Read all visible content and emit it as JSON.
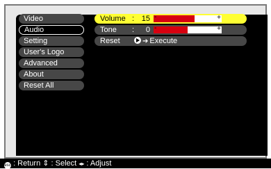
{
  "menu": {
    "items": [
      {
        "label": "Video"
      },
      {
        "label": "Audio"
      },
      {
        "label": "Setting"
      },
      {
        "label": "User's Logo"
      },
      {
        "label": "Advanced"
      },
      {
        "label": "About"
      },
      {
        "label": "Reset All"
      }
    ],
    "selected": "Audio"
  },
  "audio": {
    "volume": {
      "label": "Volume",
      "colon": ":",
      "value": "15",
      "level": 0.6
    },
    "tone": {
      "label": "Tone",
      "colon": ":",
      "value": "0",
      "level": 0.5
    },
    "reset": {
      "label": "Reset",
      "action": "Execute"
    }
  },
  "footer": {
    "return_icon": "esc",
    "return_label": ": Return",
    "select_icon": "⇕",
    "select_label": ": Select",
    "adjust_icon": "◂▸",
    "adjust_label": ": Adjust"
  },
  "colors": {
    "highlight": "#ffff33",
    "bar_fill": "#d70010",
    "item_bg": "#474747"
  }
}
